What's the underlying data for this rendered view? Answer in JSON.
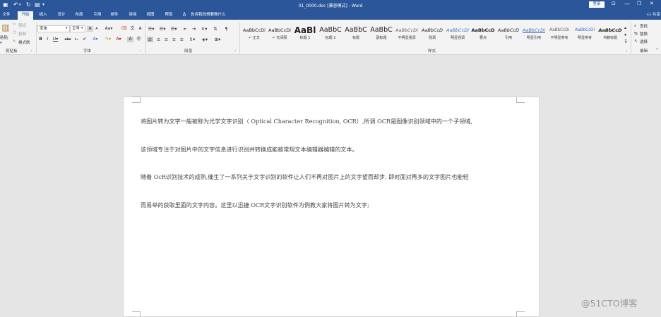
{
  "titlebar": {
    "title": "01_0000.doc [兼容模式] - Word",
    "login": "登录",
    "min": "—",
    "restore": "❐",
    "close": "✕"
  },
  "tabs": [
    {
      "label": "文件"
    },
    {
      "label": "开始"
    },
    {
      "label": "插入"
    },
    {
      "label": "设计"
    },
    {
      "label": "布局"
    },
    {
      "label": "引用"
    },
    {
      "label": "邮件"
    },
    {
      "label": "审阅"
    },
    {
      "label": "视图"
    },
    {
      "label": "帮助"
    }
  ],
  "tellme": "告诉我你想要做什么",
  "share": "共享",
  "clipboard": {
    "paste": "粘贴",
    "cut": "剪切",
    "copy": "复制",
    "format_painter": "格式刷",
    "group": "剪贴板"
  },
  "font": {
    "name": "宋体",
    "size": "五号",
    "group": "字体"
  },
  "paragraph": {
    "group": "段落"
  },
  "styles": {
    "group": "样式",
    "items": [
      {
        "sample": "AaBbCcDi",
        "name": "↵ 正文"
      },
      {
        "sample": "AaBbCcDi",
        "name": "↵ 无间隔"
      },
      {
        "sample": "AaBl",
        "name": "标题 1"
      },
      {
        "sample": "AaBbC",
        "name": "标题 2"
      },
      {
        "sample": "AaBbC",
        "name": "标题"
      },
      {
        "sample": "AaBbC",
        "name": "副标题"
      },
      {
        "sample": "AaBbCcDi",
        "name": "不明显强调"
      },
      {
        "sample": "AaBbCcD",
        "name": "强调"
      },
      {
        "sample": "AaBbCcDi",
        "name": "明显强调"
      },
      {
        "sample": "AaBbCcD",
        "name": "要点"
      },
      {
        "sample": "AaBbCcD",
        "name": "引用"
      },
      {
        "sample": "AaBbCcDi",
        "name": "明显引用"
      },
      {
        "sample": "AaBbCcDi",
        "name": "不明显参考"
      },
      {
        "sample": "AaBbCcDi",
        "name": "明显参考"
      },
      {
        "sample": "AaBbCcD",
        "name": "书籍标题"
      }
    ]
  },
  "editing": {
    "find": "查找",
    "replace": "替换",
    "select": "选择",
    "group": "编辑"
  },
  "document": {
    "paragraphs": [
      "将图片转为文字一般被称为光学文字识别（ Optical Character Recognition, OCR）,所调 OCR是图像识别领域中的一个子领域,",
      "该领域专注于对图片中的文字信息进行识别并转换成能被常规文本编辑器编辑的文本。",
      "随着 OcR识别技术的成熟,催生了一系列关于文字识别的软件让人们不再对图片上的文字望而却步, 即时面对再多的文字图片也能轻",
      "而易举的获取里面的文字内容。这里以迅捷 OCR文字识别软件为例教大家将图片转为文字;"
    ]
  },
  "watermark": "@51CTO博客",
  "colors": {
    "accent": "#2b579a",
    "ribbon": "#f3f3f3",
    "canvas": "#e5e5e5"
  }
}
